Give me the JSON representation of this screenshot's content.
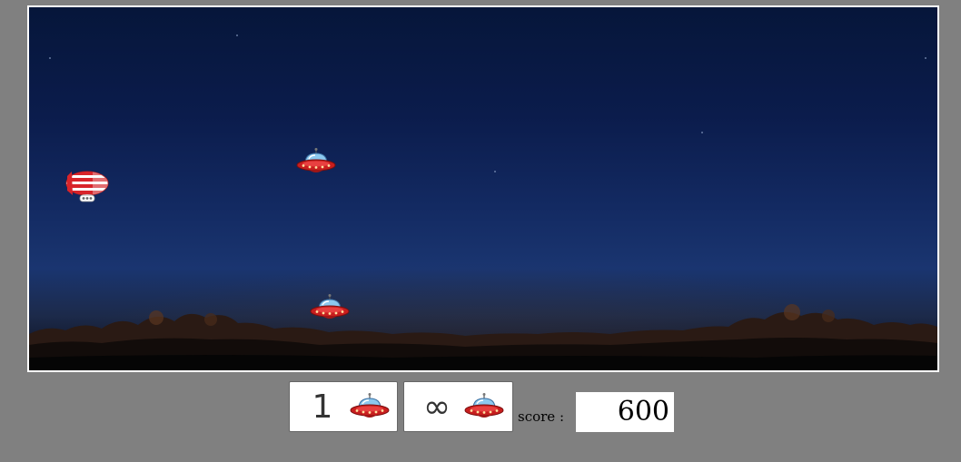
{
  "game": {
    "player": "blimp",
    "enemies": [
      "ufo",
      "ufo"
    ]
  },
  "hud": {
    "lives_count": "1",
    "lives_icon": "ufo-icon",
    "ammo_count": "∞",
    "ammo_icon": "ufo-icon",
    "score_label": "score :",
    "score_value": "600"
  },
  "colors": {
    "page_background": "#808080",
    "sky_top": "#06163a",
    "sky_bottom": "#1a3570",
    "blimp_red": "#d8242a",
    "ufo_red": "#c81e1e",
    "ufo_dome": "#8cc8ee"
  }
}
